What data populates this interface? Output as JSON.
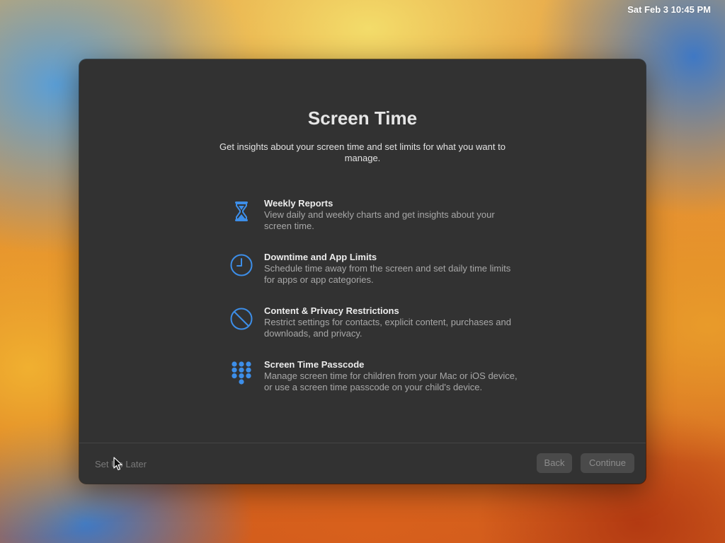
{
  "menubar": {
    "clock": "Sat Feb 3  10:45 PM"
  },
  "dialog": {
    "title": "Screen Time",
    "subtitle": "Get insights about your screen time and set limits for what you want to manage.",
    "features": [
      {
        "icon": "hourglass-icon",
        "title": "Weekly Reports",
        "description": "View daily and weekly charts and get insights about your screen time."
      },
      {
        "icon": "clock-icon",
        "title": "Downtime and App Limits",
        "description": "Schedule time away from the screen and set daily time limits for apps or app categories."
      },
      {
        "icon": "prohibited-icon",
        "title": "Content & Privacy Restrictions",
        "description": "Restrict settings for contacts, explicit content, purchases and downloads, and privacy."
      },
      {
        "icon": "keypad-icon",
        "title": "Screen Time Passcode",
        "description": "Manage screen time for children from your Mac or iOS device, or use a screen time passcode on your child's device."
      }
    ],
    "footer": {
      "later_label": "Set Up Later",
      "back_label": "Back",
      "continue_label": "Continue"
    }
  },
  "colors": {
    "accent": "#3d8ee8",
    "window_bg": "#323232"
  }
}
